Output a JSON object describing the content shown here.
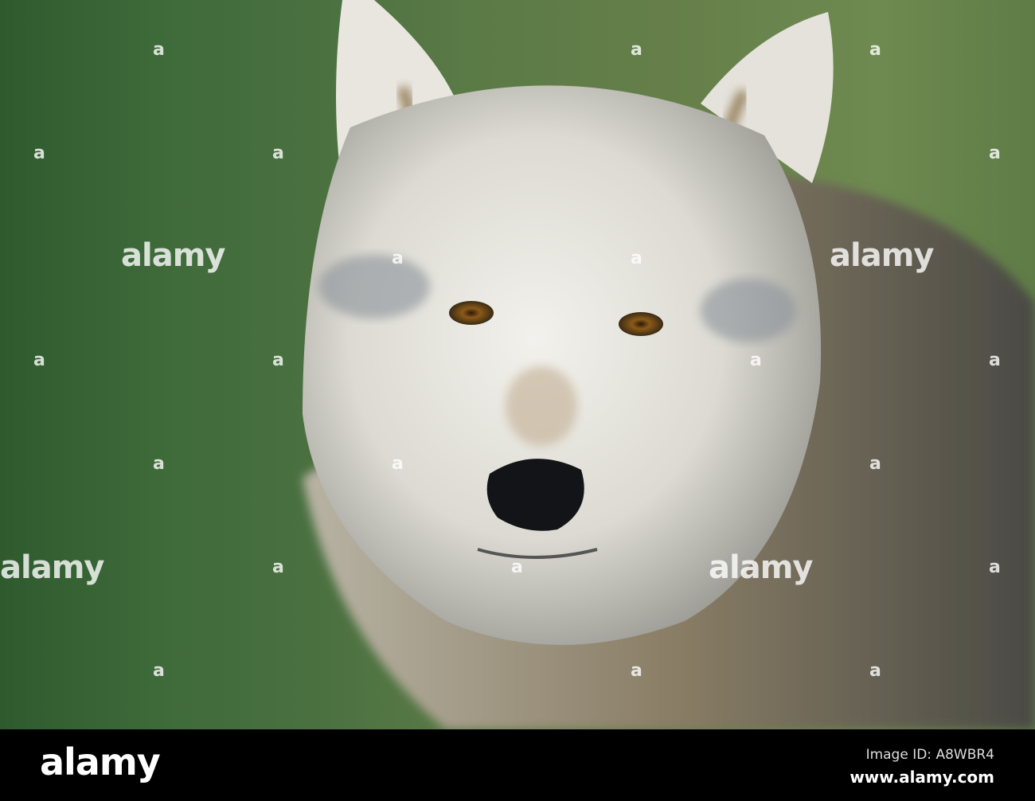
{
  "photo": {
    "subject": "wolf",
    "watermark_text": "alamy",
    "watermark_mark": "a"
  },
  "footer": {
    "logo": "alamy",
    "image_id": "Image ID: A8WBR4",
    "website": "www.alamy.com"
  }
}
